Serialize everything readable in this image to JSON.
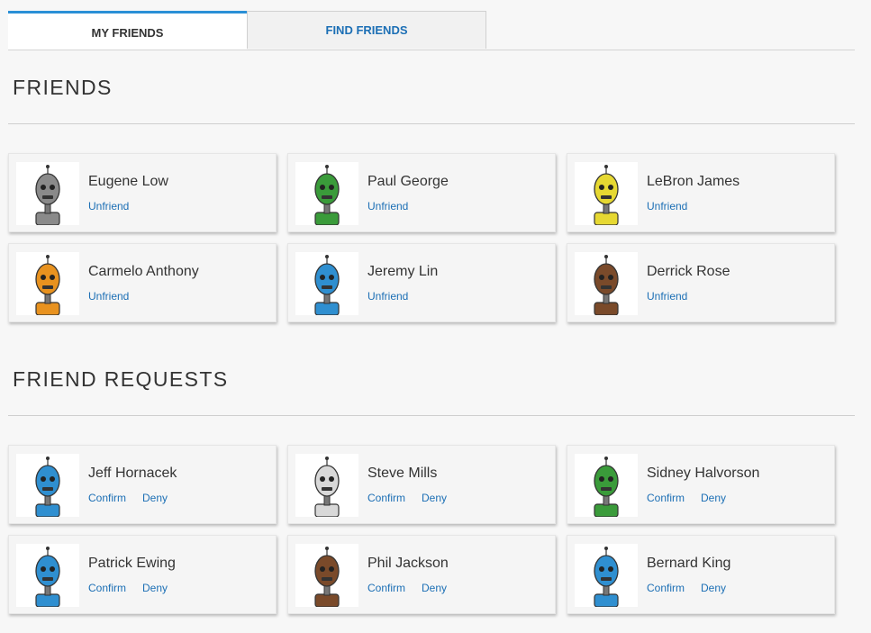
{
  "tabs": {
    "my_friends": "MY FRIENDS",
    "find_friends": "FIND FRIENDS"
  },
  "friends_section": {
    "title": "FRIENDS",
    "items": [
      {
        "name": "Eugene Low",
        "action": "Unfriend",
        "color": "#8a8a8a"
      },
      {
        "name": "Paul George",
        "action": "Unfriend",
        "color": "#3a9b3a"
      },
      {
        "name": "LeBron James",
        "action": "Unfriend",
        "color": "#e6d832"
      },
      {
        "name": "Carmelo Anthony",
        "action": "Unfriend",
        "color": "#e8921f"
      },
      {
        "name": "Jeremy Lin",
        "action": "Unfriend",
        "color": "#2f8fd0"
      },
      {
        "name": "Derrick Rose",
        "action": "Unfriend",
        "color": "#7a4a2a"
      }
    ]
  },
  "requests_section": {
    "title": "FRIEND REQUESTS",
    "confirm_label": "Confirm",
    "deny_label": "Deny",
    "items": [
      {
        "name": "Jeff Hornacek",
        "color": "#2f8fd0"
      },
      {
        "name": "Steve Mills",
        "color": "#d8d8d8"
      },
      {
        "name": "Sidney Halvorson",
        "color": "#3a9b3a"
      },
      {
        "name": "Patrick Ewing",
        "color": "#2f8fd0"
      },
      {
        "name": "Phil Jackson",
        "color": "#7a4a2a"
      },
      {
        "name": "Bernard King",
        "color": "#2f8fd0"
      }
    ]
  }
}
